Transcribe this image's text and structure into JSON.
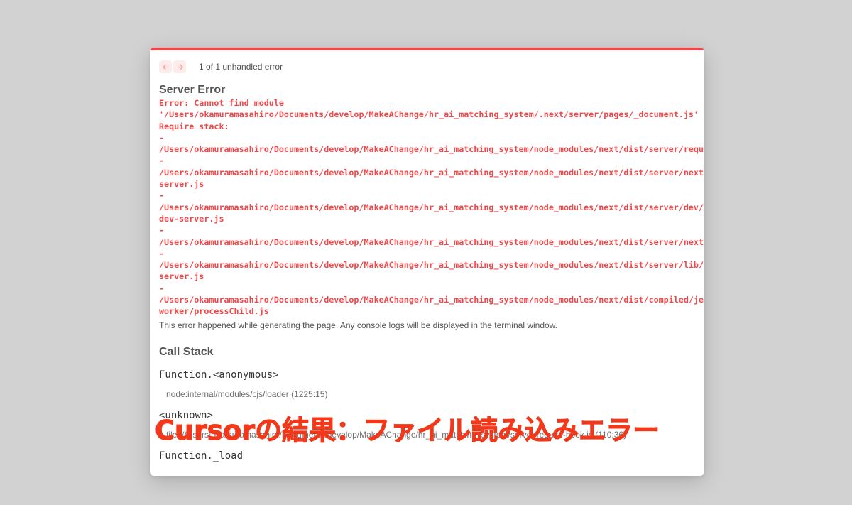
{
  "nav": {
    "error_count": "1 of 1 unhandled error"
  },
  "server_error": {
    "title": "Server Error",
    "message_lines": [
      "Error: Cannot find module",
      "'/Users/okamuramasahiro/Documents/develop/MakeAChange/hr_ai_matching_system/.next/server/pages/_document.js'",
      "Require stack:",
      "-",
      "/Users/okamuramasahiro/Documents/develop/MakeAChange/hr_ai_matching_system/node_modules/next/dist/server/require",
      "-",
      "/Users/okamuramasahiro/Documents/develop/MakeAChange/hr_ai_matching_system/node_modules/next/dist/server/next-",
      "server.js",
      "-",
      "/Users/okamuramasahiro/Documents/develop/MakeAChange/hr_ai_matching_system/node_modules/next/dist/server/dev/nex",
      "dev-server.js",
      "-",
      "/Users/okamuramasahiro/Documents/develop/MakeAChange/hr_ai_matching_system/node_modules/next/dist/server/next.js",
      "-",
      "/Users/okamuramasahiro/Documents/develop/MakeAChange/hr_ai_matching_system/node_modules/next/dist/server/lib/ren",
      "server.js",
      "-",
      "/Users/okamuramasahiro/Documents/develop/MakeAChange/hr_ai_matching_system/node_modules/next/dist/compiled/jest-",
      "worker/processChild.js"
    ],
    "info": "This error happened while generating the page. Any console logs will be displayed in the terminal window."
  },
  "call_stack": {
    "title": "Call Stack",
    "frames": [
      {
        "fn": "Function.<anonymous>",
        "loc": "node:internal/modules/cjs/loader (1225:15)"
      },
      {
        "fn": "<unknown>",
        "loc": "file:///Users/okamuramasahiro/Documents/develop/MakeAChange/hr_ai_matching_system/server/require-hook.js (110:36)"
      },
      {
        "fn": "Function._load",
        "loc": ""
      }
    ]
  },
  "overlay": {
    "caption": "Cursorの結果：ファイル読み込みエラー"
  },
  "colors": {
    "accent_red": "#f0484a",
    "caption_red": "#f2381a"
  },
  "icons": [
    "arrow-left-icon",
    "arrow-right-icon"
  ]
}
